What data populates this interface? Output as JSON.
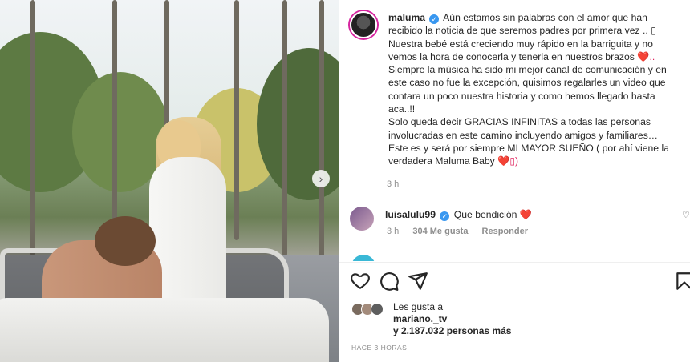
{
  "post": {
    "author": "maluma",
    "caption_lines": [
      "Aún estamos sin palabras con el amor que han",
      "recibido la noticia de que seremos padres por primera vez .. ",
      "Nuestra bebé está creciendo muy rápido en la barriguita y no",
      "vemos la hora de conocerla y tenerla en nuestros brazos ",
      "Siempre la música ha sido mi mejor canal de comunicación y en",
      "este caso no fue la excepción, quisimos regalarles un video que",
      "contara un poco nuestra historia y como hemos llegado hasta",
      "aca..!!",
      "Solo queda decir GRACIAS INFINITAS a todas las personas",
      "involucradas en este camino incluyendo amigos y familiares…",
      "Este es y será por siempre MI MAYOR SUEÑO ( por ahí viene la",
      "verdadera Maluma Baby "
    ],
    "caption_line2_end": "▯",
    "caption_line4_end": "❤️..",
    "caption_line12_end": "❤️▯)",
    "time": "3 h"
  },
  "comment": {
    "author": "luisalulu99",
    "text": "Que bendición",
    "emoji": "❤️",
    "time": "3 h",
    "likes": "304 Me gusta",
    "reply": "Responder"
  },
  "partial_comment": "··· ·· ···· ···· ·· ·· ····· ····",
  "likes": {
    "prefix": "Les gusta a",
    "user": "mariano._tv",
    "suffix": "y 2.187.032 personas más"
  },
  "date": "HACE 3 HORAS",
  "icons": {
    "verified": "verified-badge-icon",
    "next": "chevron-right-icon",
    "like": "heart-icon",
    "comment": "comment-icon",
    "share": "send-icon",
    "save": "bookmark-icon"
  }
}
